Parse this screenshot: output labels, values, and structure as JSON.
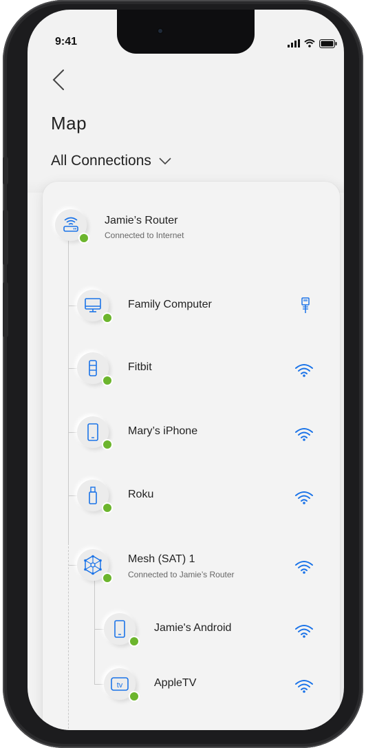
{
  "status_bar": {
    "time": "9:41"
  },
  "header": {
    "title": "Map",
    "filter_label": "All Connections"
  },
  "router": {
    "name": "Jamie’s Router",
    "status": "Connected to Internet"
  },
  "devices": [
    {
      "name": "Family Computer",
      "icon": "monitor-icon",
      "connection": "ethernet-icon"
    },
    {
      "name": "Fitbit",
      "icon": "fitbit-icon",
      "connection": "wifi-icon"
    },
    {
      "name": "Mary’s iPhone",
      "icon": "phone-icon",
      "connection": "wifi-icon"
    },
    {
      "name": "Roku",
      "icon": "roku-stick-icon",
      "connection": "wifi-icon"
    }
  ],
  "mesh": {
    "name": "Mesh (SAT) 1",
    "status": "Connected to Jamie’s Router",
    "connection": "wifi-icon"
  },
  "mesh_devices": [
    {
      "name": "Jamie's Android",
      "icon": "phone-icon",
      "connection": "wifi-icon"
    },
    {
      "name": "AppleTV",
      "icon": "tv-icon",
      "connection": "wifi-icon"
    }
  ],
  "colors": {
    "accent": "#1a73e8",
    "online": "#6cb52d"
  }
}
